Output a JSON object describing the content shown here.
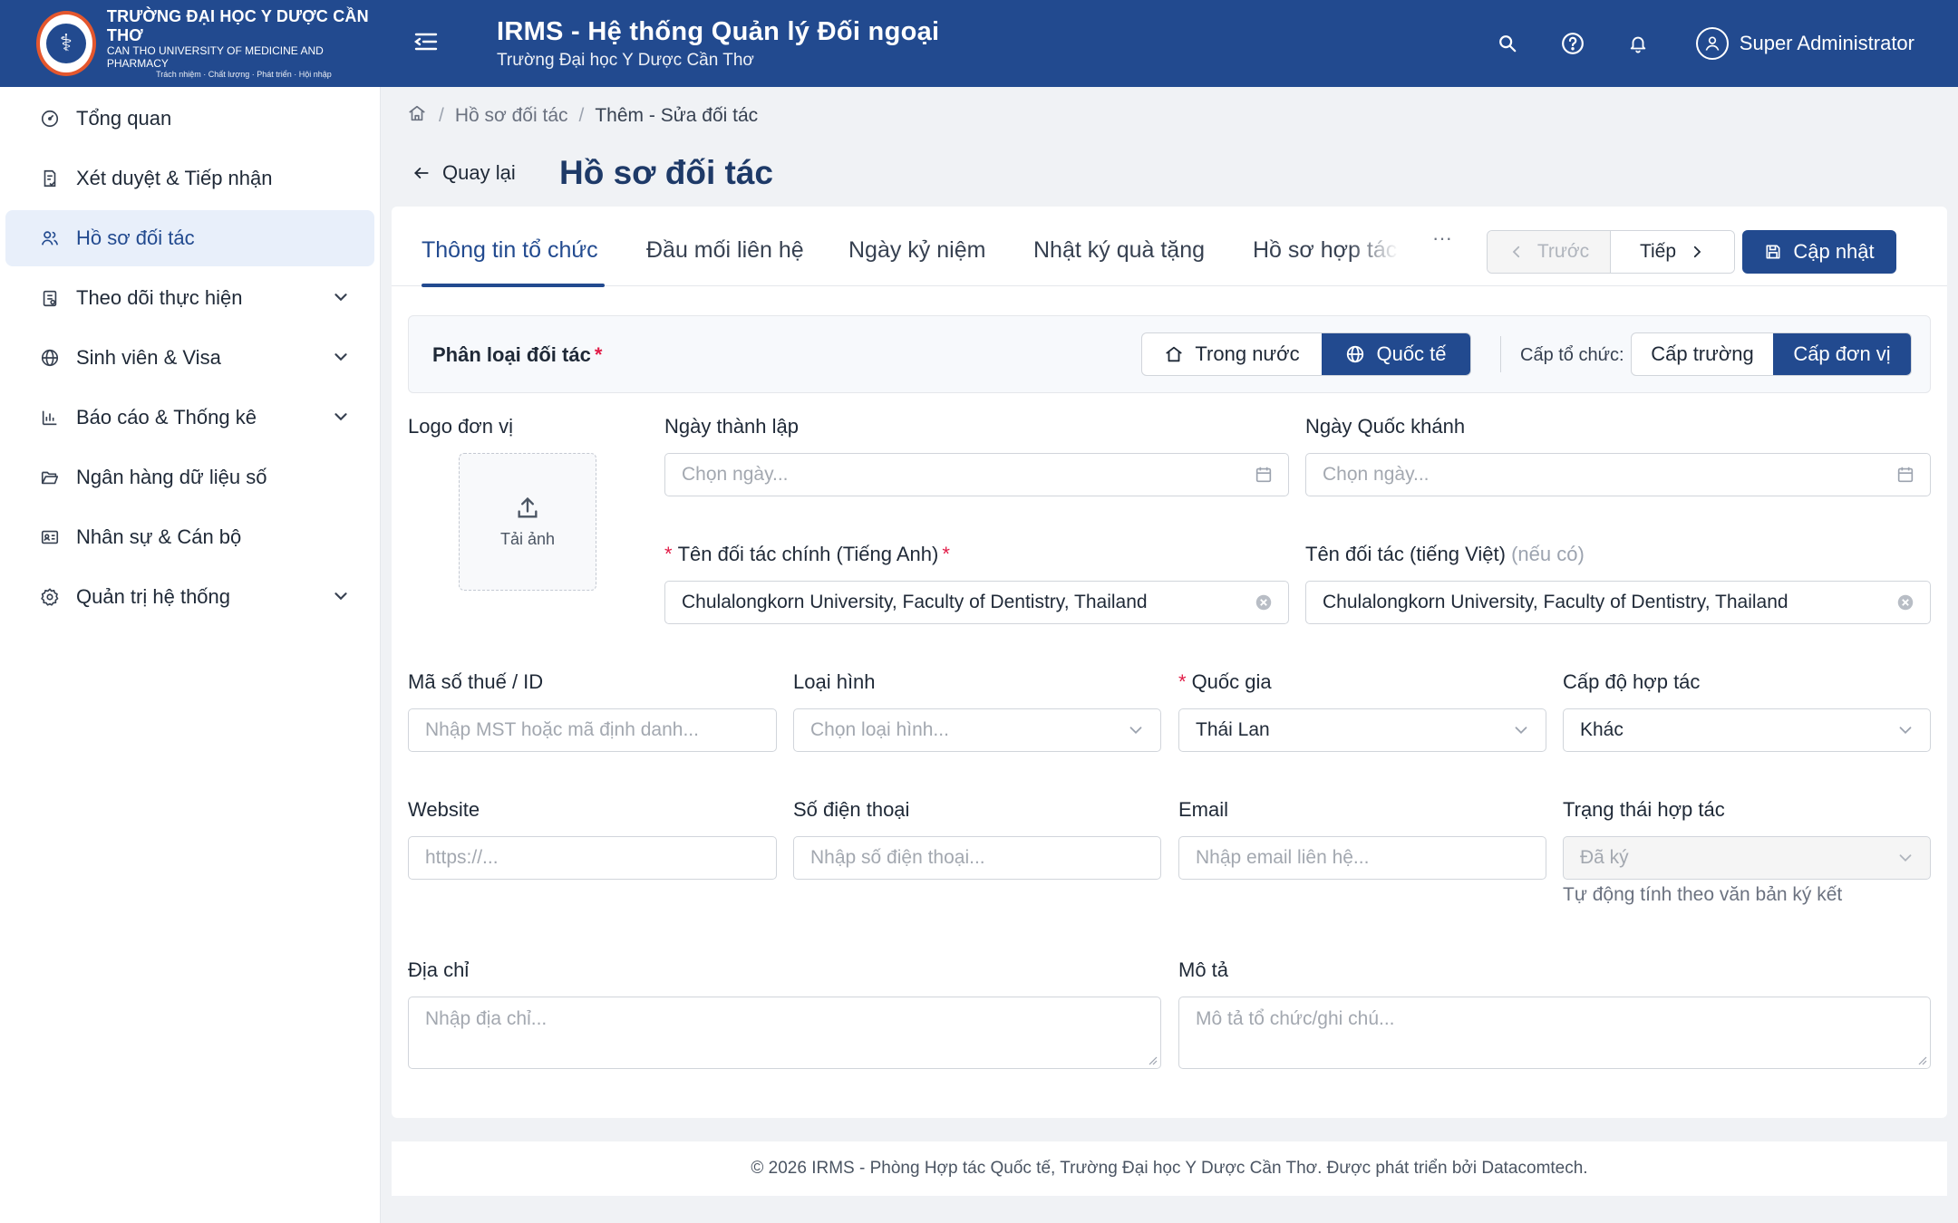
{
  "header": {
    "logo_line1": "TRƯỜNG ĐẠI HỌC Y DƯỢC CẦN THƠ",
    "logo_line2": "CAN THO UNIVERSITY OF MEDICINE AND PHARMACY",
    "logo_line3": "Trách nhiệm · Chất lượng · Phát triển · Hội nhập",
    "app_title": "IRMS - Hệ thống Quản lý Đối ngoại",
    "app_subtitle": "Trường Đại học Y Dược Cần Thơ",
    "user_name": "Super Administrator"
  },
  "sidebar": {
    "items": [
      {
        "label": "Tổng quan"
      },
      {
        "label": "Xét duyệt & Tiếp nhận"
      },
      {
        "label": "Hồ sơ đối tác"
      },
      {
        "label": "Theo dõi thực hiện"
      },
      {
        "label": "Sinh viên & Visa"
      },
      {
        "label": "Báo cáo & Thống kê"
      },
      {
        "label": "Ngân hàng dữ liệu số"
      },
      {
        "label": "Nhân sự & Cán bộ"
      },
      {
        "label": "Quản trị hệ thống"
      }
    ]
  },
  "breadcrumb": {
    "parent": "Hồ sơ đối tác",
    "current": "Thêm - Sửa đối tác"
  },
  "page": {
    "back_label": "Quay lại",
    "title": "Hồ sơ đối tác"
  },
  "tabs": [
    {
      "label": "Thông tin tổ chức"
    },
    {
      "label": "Đầu mối liên hệ"
    },
    {
      "label": "Ngày kỷ niệm"
    },
    {
      "label": "Nhật ký quà tặng"
    },
    {
      "label": "Hồ sơ hợp tác"
    }
  ],
  "toolbar": {
    "more": "···",
    "prev_label": "Trước",
    "next_label": "Tiếp",
    "update_label": "Cập nhật"
  },
  "classification": {
    "label": "Phân loại đối tác",
    "required": "*",
    "domestic_label": "Trong nước",
    "international_label": "Quốc tế",
    "level_label": "Cấp tổ chức:",
    "level_school": "Cấp trường",
    "level_unit": "Cấp đơn vị"
  },
  "form": {
    "logo_label": "Logo đơn vị",
    "upload_label": "Tải ảnh",
    "founded_label": "Ngày thành lập",
    "founded_placeholder": "Chọn ngày...",
    "national_day_label": "Ngày Quốc khánh",
    "national_day_placeholder": "Chọn ngày...",
    "name_en_label": "Tên đối tác chính (Tiếng Anh)",
    "name_en_value": "Chulalongkorn University, Faculty of Dentistry, Thailand",
    "name_vi_label": "Tên đối tác (tiếng Việt)",
    "name_vi_hint": "(nếu có)",
    "name_vi_value": "Chulalongkorn University, Faculty of Dentistry, Thailand",
    "tax_label": "Mã số thuế / ID",
    "tax_placeholder": "Nhập MST hoặc mã định danh...",
    "type_label": "Loại hình",
    "type_placeholder": "Chọn loại hình...",
    "country_label": "Quốc gia",
    "country_value": "Thái Lan",
    "coop_level_label": "Cấp độ hợp tác",
    "coop_level_value": "Khác",
    "website_label": "Website",
    "website_placeholder": "https://...",
    "phone_label": "Số điện thoại",
    "phone_placeholder": "Nhập số điện thoại...",
    "email_label": "Email",
    "email_placeholder": "Nhập email liên hệ...",
    "status_label": "Trạng thái hợp tác",
    "status_value": "Đã ký",
    "status_help": "Tự động tính theo văn bản ký kết",
    "address_label": "Địa chỉ",
    "address_placeholder": "Nhập địa chỉ...",
    "desc_label": "Mô tả",
    "desc_placeholder": "Mô tả tổ chức/ghi chú..."
  },
  "footer": {
    "text": "© 2026 IRMS - Phòng Hợp tác Quốc tế, Trường Đại học Y Dược Cần Thơ. Được phát triển bởi Datacomtech."
  },
  "colors": {
    "primary": "#224a8f",
    "required": "#e11d48",
    "sidebar_active_bg": "#e8effa"
  }
}
